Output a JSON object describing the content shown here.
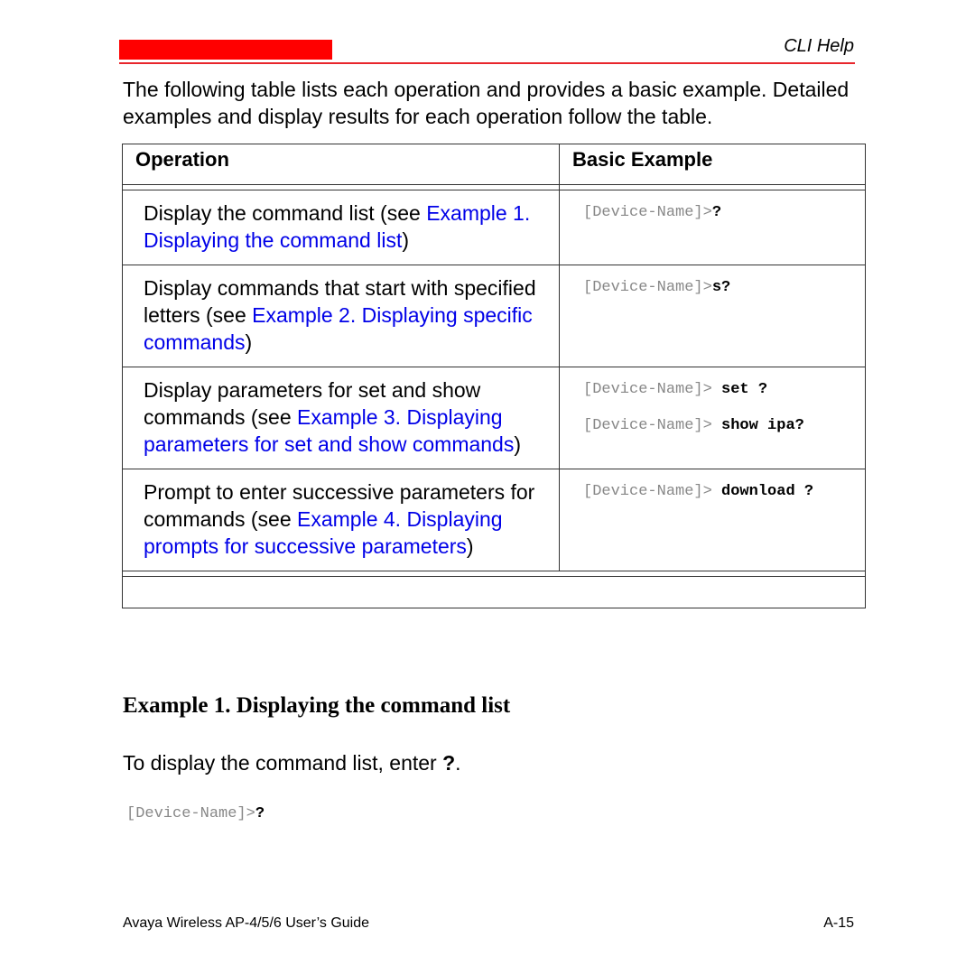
{
  "header": {
    "title": "CLI Help",
    "accent_color": "#ff0000"
  },
  "intro": "The following table lists each operation and provides a basic example. Detailed examples and display results for each operation follow the table.",
  "table": {
    "columns": [
      "Operation",
      "Basic Example"
    ],
    "rows": [
      {
        "op_text": "Display the command list (see ",
        "op_link": "Example 1. Displaying the command list",
        "op_close": ")",
        "examples": [
          {
            "prompt": "[Device-Name]>",
            "cmd": "?"
          }
        ]
      },
      {
        "op_text": "Display commands that start with specified letters (see ",
        "op_link": "Example 2. Displaying specific commands",
        "op_close": ")",
        "examples": [
          {
            "prompt": "[Device-Name]>",
            "cmd": "s?"
          }
        ]
      },
      {
        "op_text": "Display parameters for set and show commands (see ",
        "op_link": "Example 3. Displaying parameters for set and show commands",
        "op_close": ")",
        "examples": [
          {
            "prompt": "[Device-Name]> ",
            "cmd": "set ?"
          },
          {
            "prompt": "[Device-Name]> ",
            "cmd": "show ipa?"
          }
        ]
      },
      {
        "op_text": "Prompt to enter successive parameters for commands (see ",
        "op_link": "Example 4. Displaying prompts for successive parameters",
        "op_close": ")",
        "examples": [
          {
            "prompt": "[Device-Name]> ",
            "cmd": "download ?"
          }
        ]
      }
    ]
  },
  "section": {
    "heading": "Example 1. Displaying the command list",
    "para_text": "To display the command list, enter ",
    "para_bold": "?",
    "para_end": ".",
    "code_prompt": "[Device-Name]>",
    "code_cmd": "?"
  },
  "footer": {
    "left": "Avaya Wireless AP-4/5/6 User’s Guide",
    "right": "A-15"
  }
}
